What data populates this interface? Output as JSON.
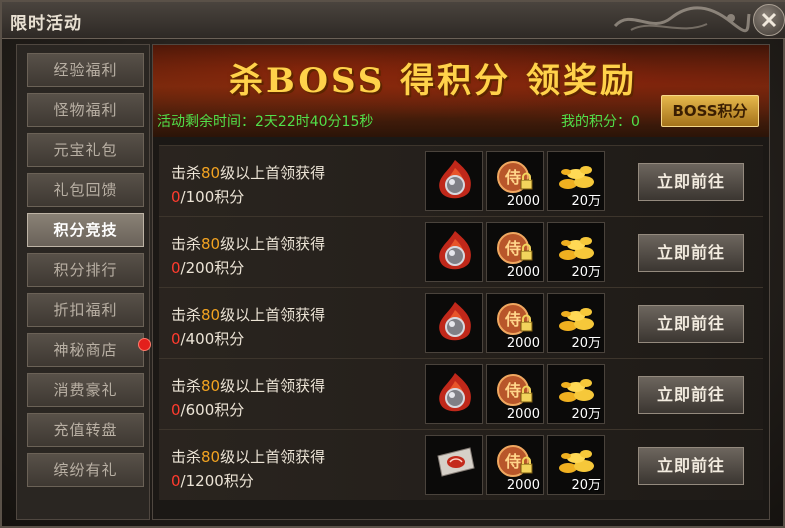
{
  "window": {
    "title": "限时活动"
  },
  "sidebar": {
    "items": [
      {
        "label": "经验福利"
      },
      {
        "label": "怪物福利"
      },
      {
        "label": "元宝礼包"
      },
      {
        "label": "礼包回馈"
      },
      {
        "label": "积分竞技",
        "active": true
      },
      {
        "label": "积分排行"
      },
      {
        "label": "折扣福利"
      },
      {
        "label": "神秘商店",
        "badge": true
      },
      {
        "label": "消费豪礼"
      },
      {
        "label": "充值转盘"
      },
      {
        "label": "缤纷有礼"
      }
    ]
  },
  "banner": {
    "title": "杀BOSS 得积分 领奖励",
    "countdown_label": "活动剩余时间：",
    "countdown_value": "2天22时40分15秒",
    "my_score_label": "我的积分：",
    "my_score_value": "0",
    "boss_button": "BOSS积分"
  },
  "rows": [
    {
      "pre": "击杀",
      "level": "80",
      "post": "级以上首领获得",
      "current": "0",
      "target": "/100积分",
      "reward1_icon": "flame-ore-icon",
      "reward2_amount": "2000",
      "reward3_amount": "20万",
      "button": "立即前往"
    },
    {
      "pre": "击杀",
      "level": "80",
      "post": "级以上首领获得",
      "current": "0",
      "target": "/200积分",
      "reward1_icon": "flame-ore-icon",
      "reward2_amount": "2000",
      "reward3_amount": "20万",
      "button": "立即前往"
    },
    {
      "pre": "击杀",
      "level": "80",
      "post": "级以上首领获得",
      "current": "0",
      "target": "/400积分",
      "reward1_icon": "flame-ore-icon",
      "reward2_amount": "2000",
      "reward3_amount": "20万",
      "button": "立即前往"
    },
    {
      "pre": "击杀",
      "level": "80",
      "post": "级以上首领获得",
      "current": "0",
      "target": "/600积分",
      "reward1_icon": "flame-ore-icon",
      "reward2_amount": "2000",
      "reward3_amount": "20万",
      "button": "立即前往"
    },
    {
      "pre": "击杀",
      "level": "80",
      "post": "级以上首领获得",
      "current": "0",
      "target": "/1200积分",
      "reward1_icon": "scroll-icon",
      "reward2_amount": "2000",
      "reward3_amount": "20万",
      "button": "立即前往"
    }
  ],
  "colors": {
    "accent_gold": "#ffd24a",
    "timer_green": "#52e04a",
    "level_orange": "#f2a321",
    "progress_red": "#ff3b2e",
    "badge_red": "#e3201c"
  }
}
